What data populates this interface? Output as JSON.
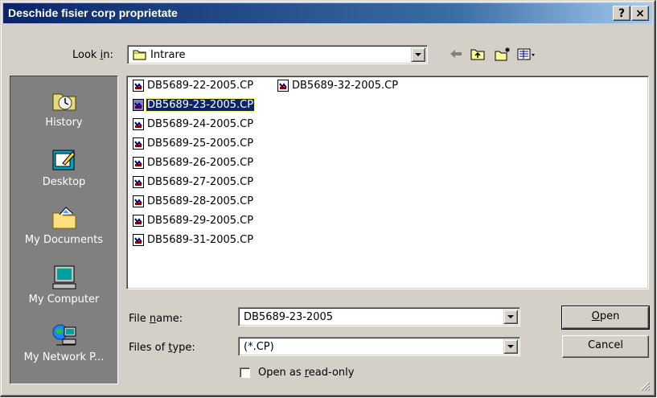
{
  "window": {
    "title": "Deschide fisier corp proprietate",
    "help_button": "?",
    "close_button": "×"
  },
  "look_in": {
    "label_pre": "Look ",
    "label_accel": "i",
    "label_post": "n:",
    "value": "Intrare",
    "folder_icon": "folder-icon"
  },
  "toolbar": {
    "back_icon": "back-arrow-icon",
    "up_icon": "up-folder-icon",
    "new_folder_icon": "new-folder-icon",
    "views_icon": "views-menu-icon"
  },
  "places": [
    {
      "label": "History",
      "icon": "history-icon"
    },
    {
      "label": "Desktop",
      "icon": "desktop-icon"
    },
    {
      "label": "My Documents",
      "icon": "my-documents-icon"
    },
    {
      "label": "My Computer",
      "icon": "my-computer-icon"
    },
    {
      "label": "My Network P...",
      "icon": "network-places-icon"
    }
  ],
  "files": [
    {
      "name": "DB5689-22-2005.CP",
      "selected": false
    },
    {
      "name": "DB5689-23-2005.CP",
      "selected": true
    },
    {
      "name": "DB5689-24-2005.CP",
      "selected": false
    },
    {
      "name": "DB5689-25-2005.CP",
      "selected": false
    },
    {
      "name": "DB5689-26-2005.CP",
      "selected": false
    },
    {
      "name": "DB5689-27-2005.CP",
      "selected": false
    },
    {
      "name": "DB5689-28-2005.CP",
      "selected": false
    },
    {
      "name": "DB5689-29-2005.CP",
      "selected": false
    },
    {
      "name": "DB5689-31-2005.CP",
      "selected": false
    },
    {
      "name": "DB5689-32-2005.CP",
      "selected": false
    }
  ],
  "file_name": {
    "label_pre": "File ",
    "label_accel": "n",
    "label_post": "ame:",
    "value": "DB5689-23-2005"
  },
  "file_type": {
    "label_pre": "Files of ",
    "label_accel": "t",
    "label_post": "ype:",
    "value": "(*.CP)"
  },
  "readonly": {
    "label_pre": "Open as ",
    "label_accel": "r",
    "label_post": "ead-only",
    "checked": false
  },
  "buttons": {
    "open_accel": "O",
    "open_rest": "pen",
    "cancel": "Cancel"
  }
}
